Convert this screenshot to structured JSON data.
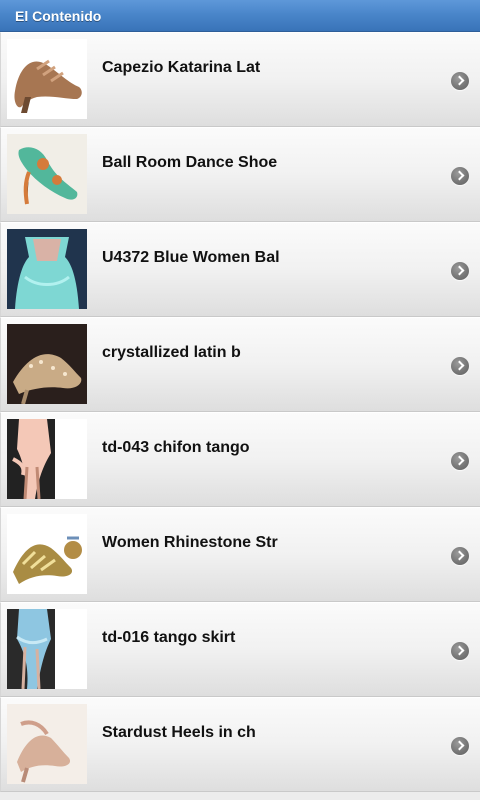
{
  "header": {
    "title": "El Contenido"
  },
  "items": [
    {
      "title": "Capezio Katarina Lat",
      "thumb": "bronze-sandal-image"
    },
    {
      "title": "Ball Room Dance Shoe",
      "thumb": "teal-shoe-image"
    },
    {
      "title": "U4372 Blue Women Bal",
      "thumb": "blue-dress-image"
    },
    {
      "title": "crystallized latin b",
      "thumb": "crystal-shoe-image"
    },
    {
      "title": "td-043 chifon tango",
      "thumb": "chiffon-skirt-image"
    },
    {
      "title": "Women Rhinestone Str",
      "thumb": "gold-rhinestone-shoe-image"
    },
    {
      "title": "td-016 tango skirt",
      "thumb": "blue-skirt-image"
    },
    {
      "title": "Stardust Heels in ch",
      "thumb": "champagne-heels-image"
    }
  ],
  "colors": {
    "header": "#4a86ca",
    "row_top": "#fbfbfb",
    "row_bottom": "#dedede",
    "chevron": "#777777"
  }
}
